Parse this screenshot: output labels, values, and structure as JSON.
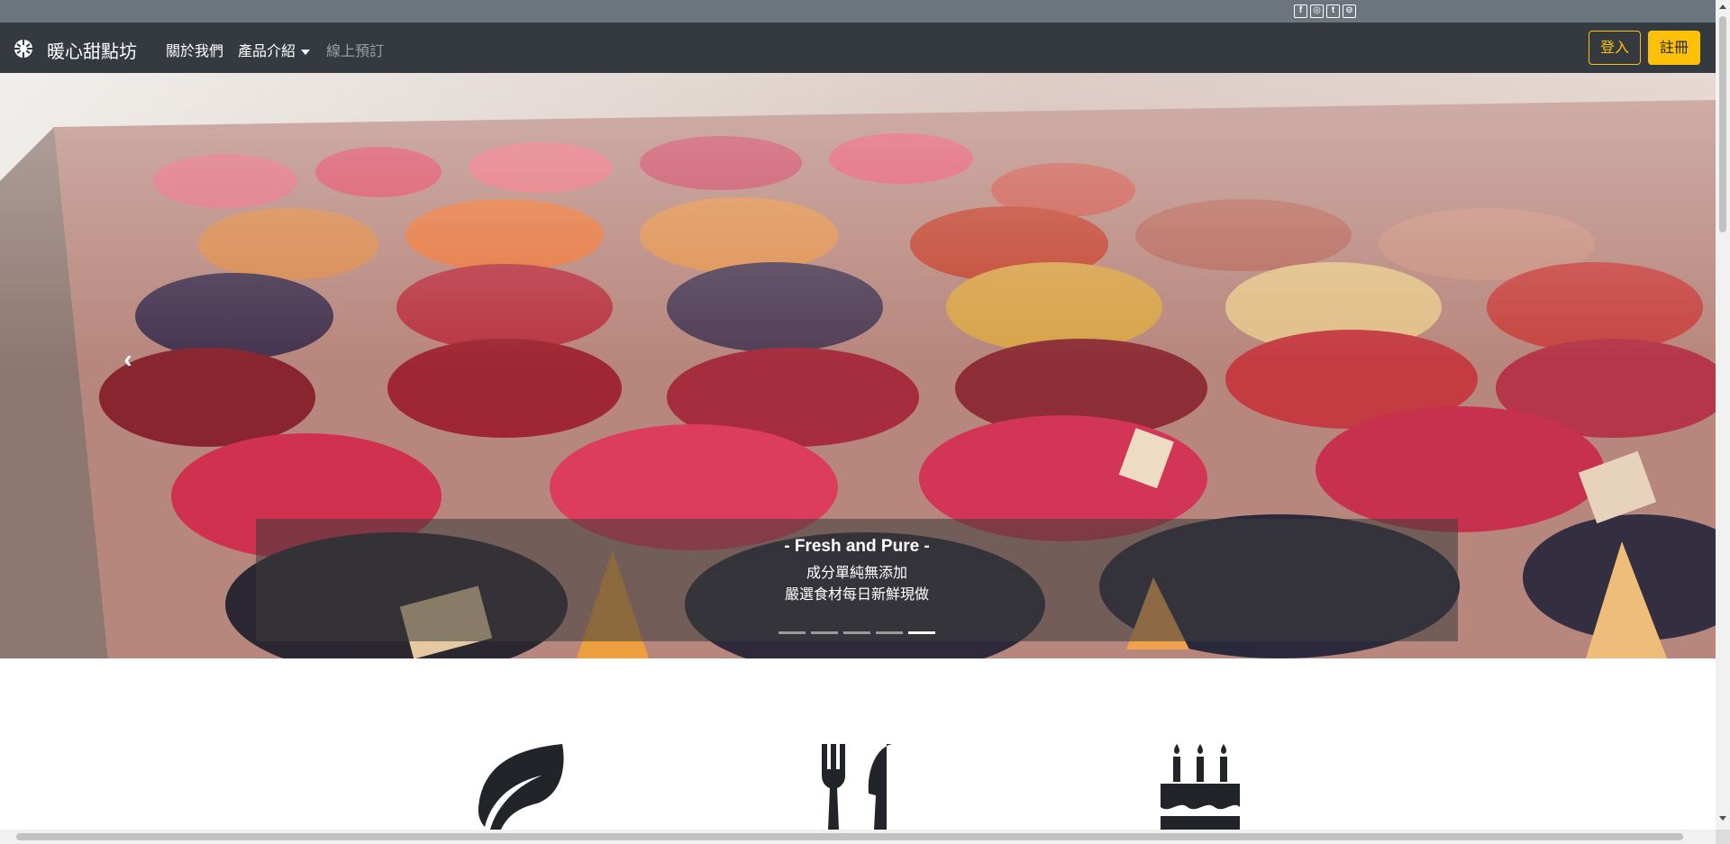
{
  "social": {
    "icons": [
      "facebook-icon",
      "instagram-icon",
      "twitter-icon",
      "line-icon"
    ],
    "glyphs": [
      "f",
      "◎",
      "t",
      "⊝"
    ]
  },
  "navbar": {
    "brand": "暖心甜點坊",
    "items": [
      {
        "label": "關於我們"
      },
      {
        "label": "產品介紹"
      },
      {
        "label": "線上預訂"
      }
    ],
    "login": "登入",
    "register": "註冊"
  },
  "carousel": {
    "caption_title": "- Fresh and Pure -",
    "caption_line1": "成分單純無添加",
    "caption_line2": "嚴選食材每日新鮮現做",
    "slide_count": 5,
    "active_index": 4,
    "prev_glyph": "‹"
  },
  "features": {
    "icons": [
      "leaf-icon",
      "utensils-icon",
      "birthday-cake-icon"
    ]
  },
  "colors": {
    "topbar": "#6c757d",
    "navbar": "#343a40",
    "accent": "#ffc107"
  }
}
